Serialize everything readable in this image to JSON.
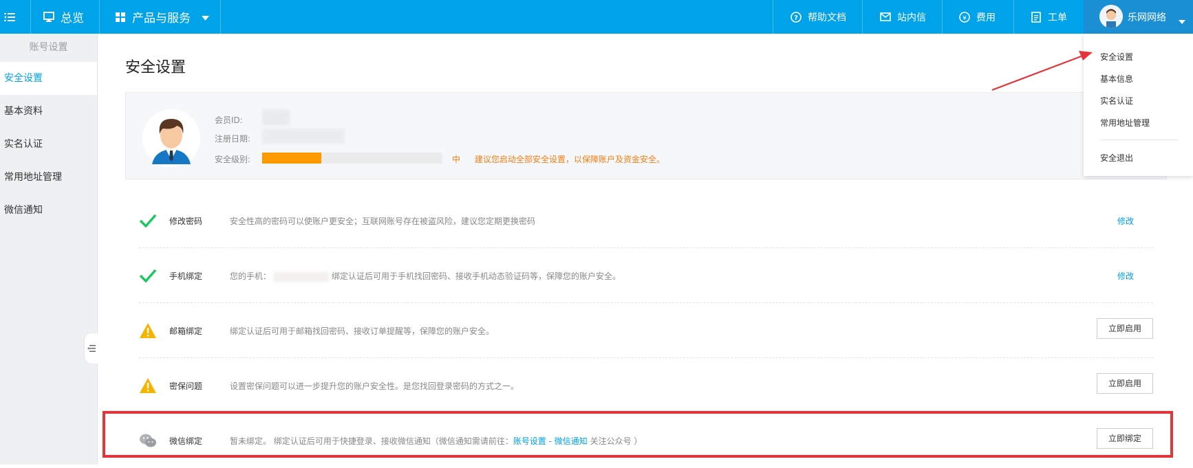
{
  "colors": {
    "brand": "#00a2ea",
    "warning": "#f57d13",
    "highlight": "#e3353b",
    "success": "#1dc760",
    "alert_icon": "#f5b400"
  },
  "topbar": {
    "menu_icon": "menu-collapse-icon",
    "overview_label": "总览",
    "products_label": "产品与服务",
    "help_label": "帮助文档",
    "messages_label": "站内信",
    "billing_label": "费用",
    "tickets_label": "工单",
    "user_name": "乐网网络"
  },
  "sidebar": {
    "title": "账号设置",
    "items": [
      {
        "label": "安全设置",
        "active": true
      },
      {
        "label": "基本资料",
        "active": false
      },
      {
        "label": "实名认证",
        "active": false
      },
      {
        "label": "常用地址管理",
        "active": false
      },
      {
        "label": "微信通知",
        "active": false
      }
    ]
  },
  "main": {
    "title": "安全设置",
    "profile": {
      "member_id_label": "会员ID:",
      "reg_date_label": "注册日期:",
      "security_level_label": "安全级别:",
      "security_level_value": "中",
      "security_level_progress": 0.33,
      "security_tip": "建议您启动全部安全设置，以保障账户及资金安全。"
    },
    "rows": [
      {
        "name": "修改密码",
        "status": "ok",
        "desc": "安全性高的密码可以使账户更安全；互联网账号存在被盗风险，建议您定期更换密码",
        "action": "修改"
      },
      {
        "name": "手机绑定",
        "status": "ok",
        "desc_prefix": "您的手机：",
        "desc_suffix": "绑定认证后可用于手机找回密码、接收手机动态验证码等，保障您的账户安全。",
        "action": "修改"
      },
      {
        "name": "邮箱绑定",
        "status": "warn",
        "desc": "绑定认证后可用于邮箱找回密码、接收订单提醒等，保障您的账户安全。",
        "action": "立即启用"
      },
      {
        "name": "密保问题",
        "status": "warn",
        "desc": "设置密保问题可以进一步提升您的账户安全性。是您找回登录密码的方式之一。",
        "action": "立即启用"
      },
      {
        "name": "微信绑定",
        "status": "wechat",
        "desc_prefix": "暂未绑定。 绑定认证后可用于快捷登录、接收微信通知（微信通知需请前往：",
        "desc_link": "账号设置 - 微信通知",
        "desc_suffix": " 关注公众号 ）",
        "action": "立即绑定"
      }
    ]
  },
  "dropdown": {
    "items": [
      "安全设置",
      "基本信息",
      "实名认证",
      "常用地址管理"
    ],
    "logout": "安全退出"
  }
}
